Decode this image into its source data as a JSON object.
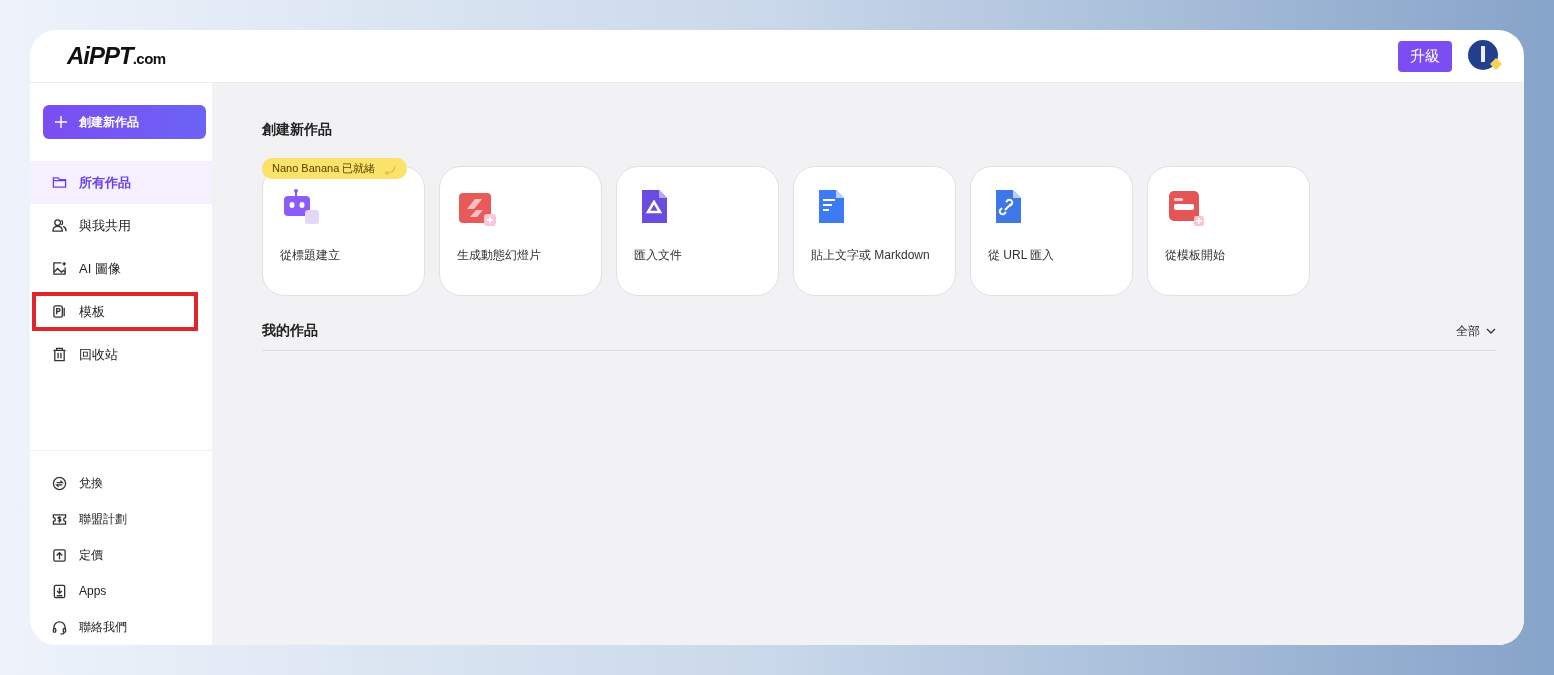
{
  "header": {
    "logo": {
      "main": "AiPPT",
      "suffix": ".com"
    },
    "upgrade_button": "升級"
  },
  "sidebar": {
    "create_button": "創建新作品",
    "items": [
      {
        "label": "所有作品",
        "kind": "folder",
        "selected": true,
        "highlighted": false
      },
      {
        "label": "與我共用",
        "kind": "users",
        "selected": false,
        "highlighted": false
      },
      {
        "label": "AI 圖像",
        "kind": "image",
        "selected": false,
        "highlighted": false
      },
      {
        "label": "模板",
        "kind": "template",
        "selected": false,
        "highlighted": true
      },
      {
        "label": "回收站",
        "kind": "trash",
        "selected": false,
        "highlighted": false
      }
    ],
    "bottom_items": [
      {
        "label": "兌換",
        "kind": "exchange"
      },
      {
        "label": "聯盟計劃",
        "kind": "ticket"
      },
      {
        "label": "定價",
        "kind": "up"
      },
      {
        "label": "Apps",
        "kind": "download"
      },
      {
        "label": "聯絡我們",
        "kind": "headset"
      }
    ]
  },
  "create_section": {
    "title": "創建新作品",
    "cards": [
      {
        "label": "從標題建立",
        "kind": "robot",
        "badge": "Nano Banana 已就緒"
      },
      {
        "label": "生成動態幻燈片",
        "kind": "slides"
      },
      {
        "label": "匯入文件",
        "kind": "drive"
      },
      {
        "label": "貼上文字或 Markdown",
        "kind": "doc"
      },
      {
        "label": "從 URL 匯入",
        "kind": "link"
      },
      {
        "label": "從模板開始",
        "kind": "template"
      }
    ]
  },
  "my_works": {
    "title": "我的作品",
    "filter": "全部"
  }
}
